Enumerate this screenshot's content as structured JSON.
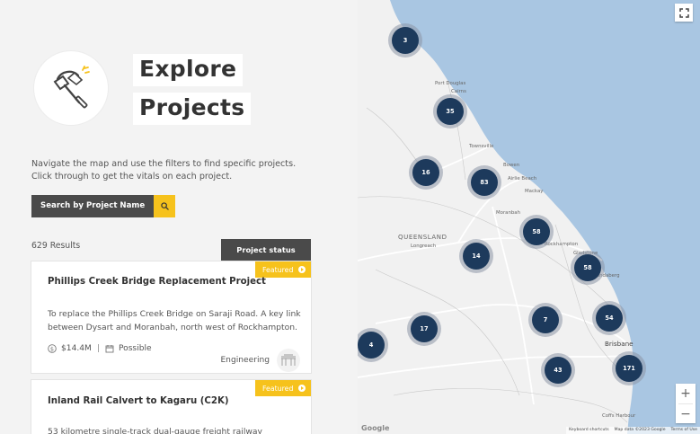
{
  "hero": {
    "title_line1": "Explore",
    "title_line2": "Projects"
  },
  "intro": "Navigate the map and use the filters to find specific projects. Click through to get the vitals on each project.",
  "search": {
    "label": "Search by Project Name"
  },
  "results_label": "629 Results",
  "legend_button": "Project status legend",
  "cards": [
    {
      "badge": "Featured",
      "title": "Phillips Creek Bridge Replacement Project",
      "description": "To replace the Phillips Creek Bridge on Saraji Road. A key link between Dysart and Moranbah, north west of Rockhampton.",
      "value": "$14.4M",
      "status": "Possible",
      "category": "Engineering"
    },
    {
      "badge": "Featured",
      "title": "Inland Rail Calvert to Kagaru (C2K)",
      "description": "53 kilometre single-track dual-gauge freight railway"
    }
  ],
  "map": {
    "clusters": [
      "3",
      "35",
      "16",
      "83",
      "58",
      "14",
      "58",
      "7",
      "54",
      "17",
      "4",
      "43",
      "171"
    ],
    "labels": {
      "port_douglas": "Port Douglas",
      "cairns": "Cairns",
      "townsville": "Townsville",
      "bowen": "Bowen",
      "airlie_beach": "Airlie Beach",
      "mackay": "Mackay",
      "moranbah": "Moranbah",
      "queensland": "QUEENSLAND",
      "longreach": "Longreach",
      "rockhampton": "Rockhampton",
      "gladstone": "Gladstone",
      "bundaberg": "Bundaberg",
      "brisbane": "Brisbane",
      "coffs_harbour": "Coffs Harbour"
    },
    "google": "Google",
    "attribution": [
      "Keyboard shortcuts",
      "Map data ©2023 Google",
      "Terms of Use"
    ],
    "zoom_in": "+",
    "zoom_out": "−"
  },
  "colors": {
    "accent": "#f6c21c",
    "dark": "#4a4a4a",
    "cluster": "#1d3a5c",
    "ocean": "#a9c6e2",
    "land": "#f1f1f1"
  }
}
